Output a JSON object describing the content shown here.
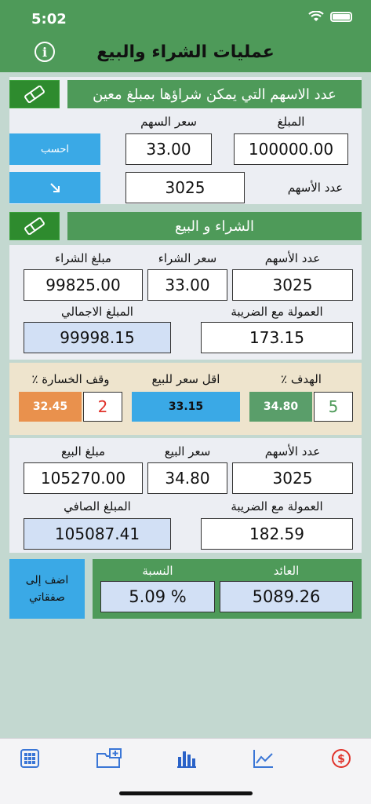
{
  "status": {
    "time": "5:02"
  },
  "header": {
    "title": "عمليات الشراء والبيع"
  },
  "calc": {
    "bar_title": "عدد الاسهم التي يمكن شراؤها بمبلغ معين",
    "amount_label": "المبلغ",
    "price_label": "سعر السهم",
    "amount_value": "100000.00",
    "price_value": "33.00",
    "calculate_button": "احسب",
    "shares_label": "عدد الأسهم",
    "shares_value": "3025"
  },
  "trade": {
    "bar_title": "الشراء و البيع",
    "buy": {
      "shares_label": "عدد الأسهم",
      "price_label": "سعر الشراء",
      "amount_label": "مبلغ الشراء",
      "shares_value": "3025",
      "price_value": "33.00",
      "amount_value": "99825.00",
      "commission_label": "العمولة مع الضريبة",
      "total_label": "المبلغ الاجمالي",
      "commission_value": "173.15",
      "total_value": "99998.15"
    },
    "targets": {
      "target_label": "الهدف ٪",
      "min_sell_label": "اقل سعر للبيع",
      "stop_loss_label": "وقف الخسارة ٪",
      "target_percent": "5",
      "target_price": "34.80",
      "min_sell_price": "33.15",
      "stop_loss_percent": "2",
      "stop_loss_price": "32.45"
    },
    "sell": {
      "shares_label": "عدد الأسهم",
      "price_label": "سعر البيع",
      "amount_label": "مبلغ البيع",
      "shares_value": "3025",
      "price_value": "34.80",
      "amount_value": "105270.00",
      "commission_label": "العمولة مع الضريبة",
      "net_label": "المبلغ الصافي",
      "commission_value": "182.59",
      "net_value": "105087.41"
    }
  },
  "result": {
    "add_button": "اضف إلى صفقاتي",
    "return_label": "العائد",
    "ratio_label": "النسبة",
    "return_value": "5089.26",
    "ratio_value": "5.09 %"
  },
  "tabbar": {
    "icons": [
      "calculator-icon",
      "add-folder-icon",
      "bar-chart-icon",
      "line-chart-icon",
      "dollar-icon"
    ],
    "active_color": "#2a62c8",
    "inactive_color": "#3a76d6",
    "dollar_color": "#e0322a"
  },
  "colors": {
    "header_green": "#4e9a59",
    "background": "#c3d8d0",
    "button_blue": "#3aa9e6",
    "target_green": "#5a9e6a",
    "stop_loss_orange": "#e9914d"
  }
}
